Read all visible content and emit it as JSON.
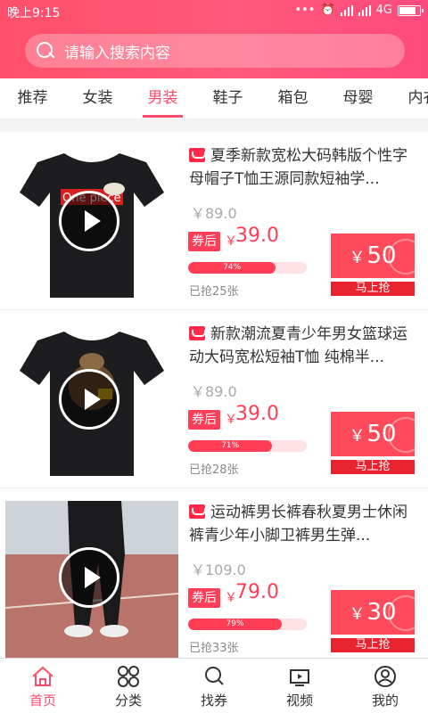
{
  "status": {
    "time": "晚上9:15",
    "network": "4G"
  },
  "search": {
    "placeholder": "请输入搜索内容"
  },
  "tabs": [
    {
      "label": "推荐"
    },
    {
      "label": "女装"
    },
    {
      "label": "男装",
      "active": true
    },
    {
      "label": "鞋子"
    },
    {
      "label": "箱包"
    },
    {
      "label": "母婴"
    },
    {
      "label": "内衣"
    }
  ],
  "products": [
    {
      "title": "夏季新款宽松大码韩版个性字母帽子T恤王源同款短袖学...",
      "orig_price": "￥89.0",
      "coupon_tag": "券后",
      "yen": "￥",
      "price": "39.0",
      "progress": "74%",
      "progress_value": 0.74,
      "sold": "已抢25张",
      "coupon_amount": "50",
      "coupon_yen": "￥",
      "grab_label": "马上抢",
      "image_text": "One piece"
    },
    {
      "title": "新款潮流夏青少年男女篮球运动大码宽松短袖T恤 纯棉半...",
      "orig_price": "￥89.0",
      "coupon_tag": "券后",
      "yen": "￥",
      "price": "39.0",
      "progress": "71%",
      "progress_value": 0.71,
      "sold": "已抢28张",
      "coupon_amount": "50",
      "coupon_yen": "￥",
      "grab_label": "马上抢"
    },
    {
      "title": "运动裤男长裤春秋夏男士休闲裤青少年小脚卫裤男生弹...",
      "orig_price": "￥109.0",
      "coupon_tag": "券后",
      "yen": "￥",
      "price": "79.0",
      "progress": "79%",
      "progress_value": 0.79,
      "sold": "已抢33张",
      "coupon_amount": "30",
      "coupon_yen": "￥",
      "grab_label": "马上抢"
    }
  ],
  "tabbar": [
    {
      "label": "首页",
      "icon": "home-icon",
      "active": true
    },
    {
      "label": "分类",
      "icon": "category-icon"
    },
    {
      "label": "找券",
      "icon": "search-icon"
    },
    {
      "label": "视频",
      "icon": "video-icon"
    },
    {
      "label": "我的",
      "icon": "profile-icon"
    }
  ],
  "colors": {
    "accent": "#ff4a6b",
    "price": "#ff3d55",
    "coupon": "#ff4a5c"
  }
}
